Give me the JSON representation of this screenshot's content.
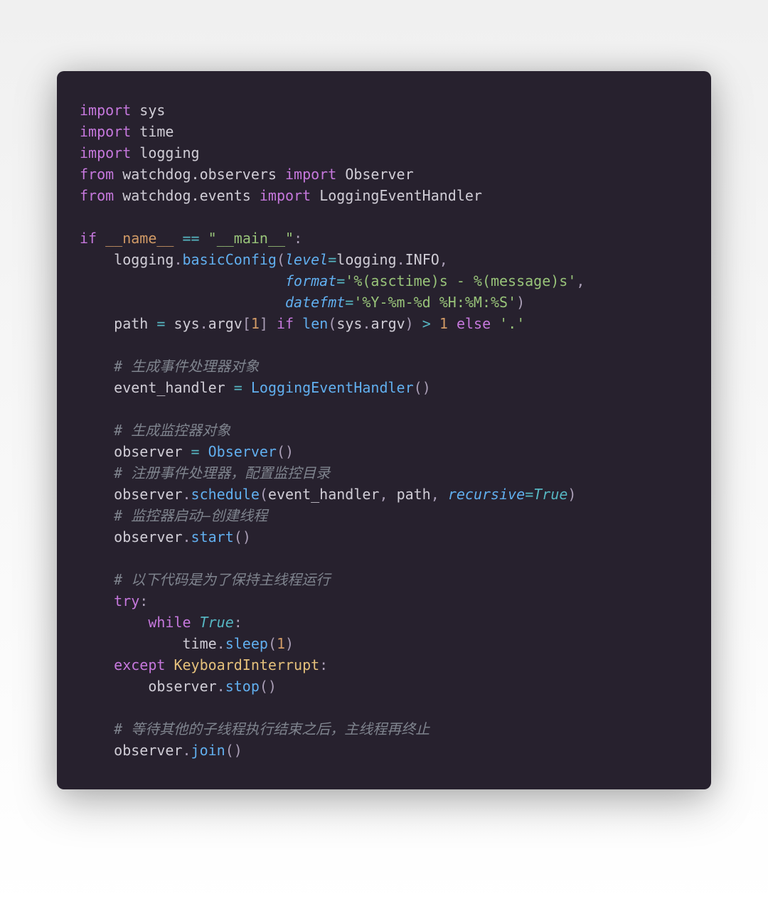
{
  "t": {
    "imp": "import",
    "frm": "from",
    "sys": "sys",
    "time": "time",
    "logging": "logging",
    "wd_obs": "watchdog.observers",
    "wd_ev": "watchdog.events",
    "Observer": "Observer",
    "LoggingEventHandler": "LoggingEventHandler",
    "if": "if",
    "name": "__name__",
    "eqeq": "==",
    "main_s": "\"__main__\"",
    "colon": ":",
    "basicConfig": "basicConfig",
    "lp": "(",
    "rp": ")",
    "lb": "[",
    "rb": "]",
    "comma": ",",
    "dot": ".",
    "eq": "=",
    "gt": ">",
    "level": "level",
    "INFO": "INFO",
    "format": "format",
    "fmt_str": "'%(asctime)s - %(message)s'",
    "datefmt": "datefmt",
    "datefmt_str": "'%Y-%m-%d %H:%M:%S'",
    "path": "path",
    "argv": "argv",
    "one": "1",
    "len": "len",
    "else": "else",
    "dot_str": "'.'",
    "c_evh": "# 生成事件处理器对象",
    "event_handler": "event_handler",
    "c_obs": "# 生成监控器对象",
    "observer": "observer",
    "c_reg": "# 注册事件处理器，配置监控目录",
    "schedule": "schedule",
    "recursive": "recursive",
    "True": "True",
    "c_start": "# 监控器启动—创建线程",
    "start": "start",
    "c_loop": "# 以下代码是为了保持主线程运行",
    "try": "try",
    "while": "while",
    "sleep": "sleep",
    "except": "except",
    "KI": "KeyboardInterrupt",
    "stop": "stop",
    "c_join": "# 等待其他的子线程执行结束之后，主线程再终止",
    "join": "join"
  }
}
